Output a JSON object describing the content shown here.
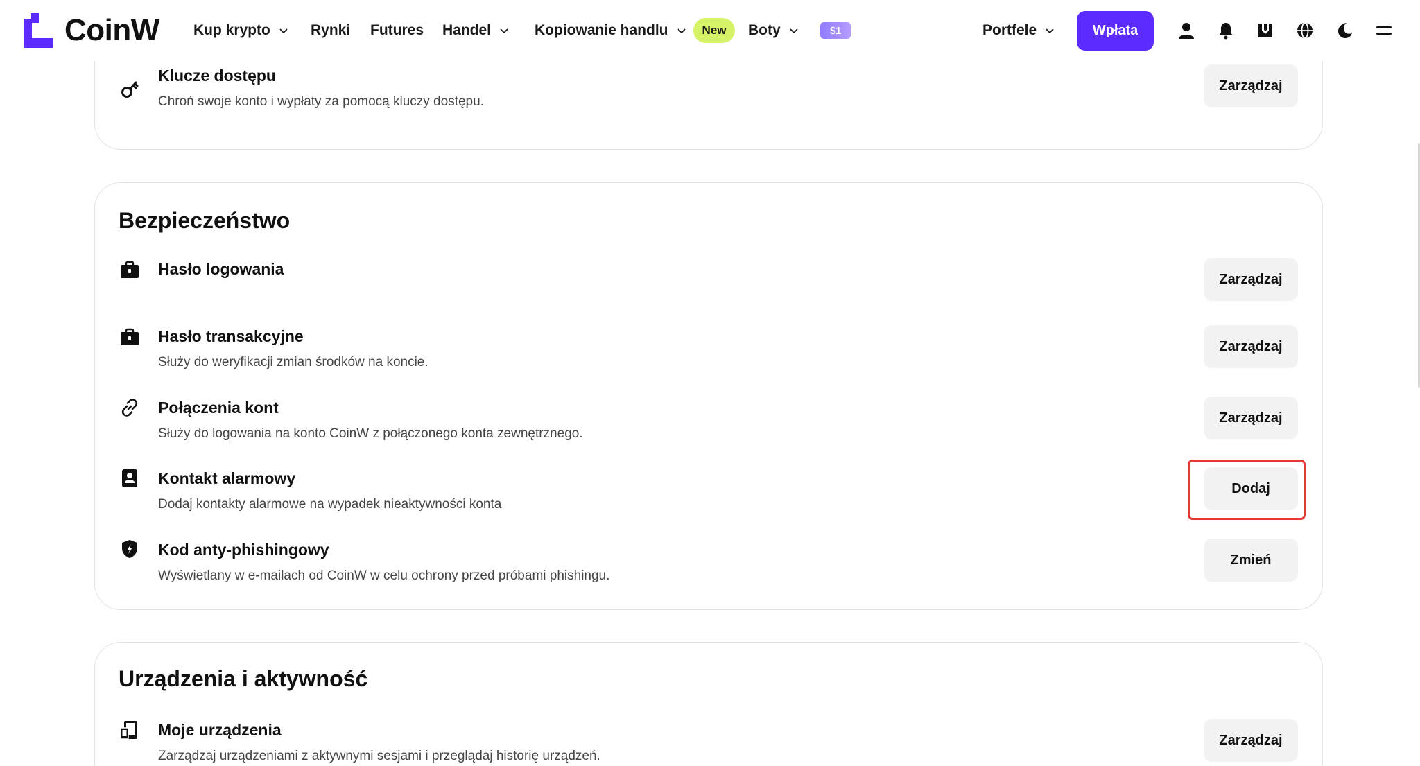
{
  "brand": {
    "name": "CoinW",
    "accent": "#5b2bff"
  },
  "nav": {
    "buy_crypto": "Kup krypto",
    "markets": "Rynki",
    "futures": "Futures",
    "trade": "Handel",
    "copy_trading": "Kopiowanie handlu",
    "new_badge": "New",
    "bots": "Boty",
    "promo": "$1"
  },
  "header": {
    "wallets": "Portfele",
    "deposit": "Wpłata"
  },
  "top_card": {
    "row": {
      "title": "Klucze dostępu",
      "desc": "Chroń swoje konto i wypłaty za pomocą kluczy dostępu.",
      "button": "Zarządzaj"
    }
  },
  "security": {
    "title": "Bezpieczeństwo",
    "rows": [
      {
        "title": "Hasło logowania",
        "desc": "",
        "button": "Zarządzaj"
      },
      {
        "title": "Hasło transakcyjne",
        "desc": "Służy do weryfikacji zmian środków na koncie.",
        "button": "Zarządzaj"
      },
      {
        "title": "Połączenia kont",
        "desc": "Służy do logowania na konto CoinW z połączonego konta zewnętrznego.",
        "button": "Zarządzaj"
      },
      {
        "title": "Kontakt alarmowy",
        "desc": "Dodaj kontakty alarmowe na wypadek nieaktywności konta",
        "button": "Dodaj"
      },
      {
        "title": "Kod anty-phishingowy",
        "desc": "Wyświetlany w e-mailach od CoinW w celu ochrony przed próbami phishingu.",
        "button": "Zmień"
      }
    ]
  },
  "devices": {
    "title": "Urządzenia i aktywność",
    "rows": [
      {
        "title": "Moje urządzenia",
        "desc": "Zarządzaj urządzeniami z aktywnymi sesjami i przeglądaj historię urządzeń.",
        "button": "Zarządzaj"
      }
    ]
  },
  "icons": {
    "key": "key-icon",
    "lock": "briefcase-lock-icon",
    "link": "link-icon",
    "contact": "contact-book-icon",
    "shield": "shield-icon",
    "device": "device-icon",
    "user": "user-icon",
    "bell": "bell-icon",
    "download": "download-icon",
    "globe": "globe-icon",
    "moon": "moon-icon",
    "menu": "menu-icon"
  },
  "colors": {
    "highlight": "#e53935",
    "new_badge": "#d6f266",
    "button_bg": "#f2f2f2"
  }
}
